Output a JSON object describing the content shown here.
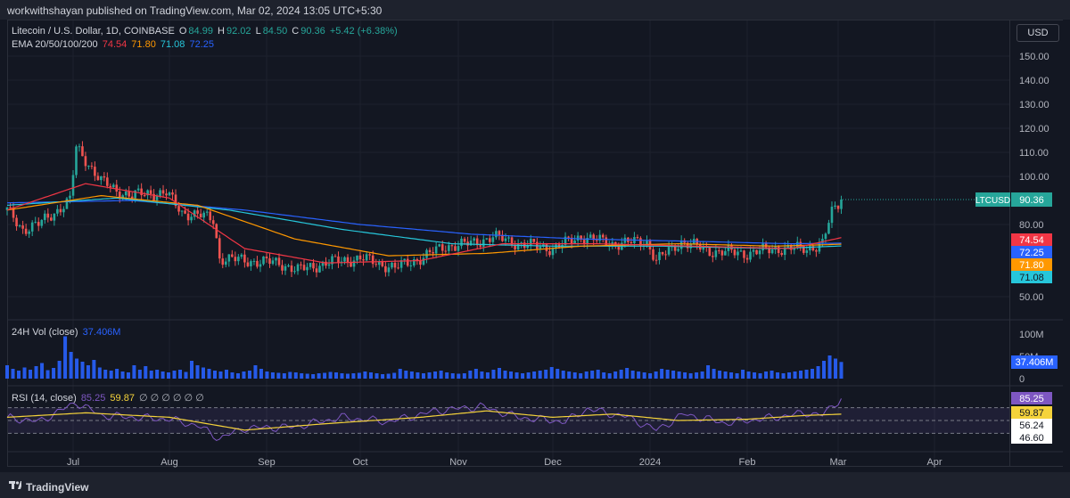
{
  "header": {
    "published_text": "workwithshayan published on TradingView.com, Mar 02, 2024 13:05 UTC+5:30"
  },
  "legend": {
    "symbol": "Litecoin / U.S. Dollar, 1D, COINBASE",
    "o_label": "O",
    "o_value": "84.99",
    "h_label": "H",
    "h_value": "92.02",
    "l_label": "L",
    "l_value": "84.50",
    "c_label": "C",
    "c_value": "90.36",
    "change": "+5.42 (+6.38%)",
    "ema_label": "EMA 20/50/100/200",
    "ema20": "74.54",
    "ema50": "71.80",
    "ema100": "71.08",
    "ema200": "72.25"
  },
  "volume_legend": {
    "label": "24H Vol (close)",
    "value": "37.406M"
  },
  "rsi_legend": {
    "label": "RSI (14, close)",
    "rsi": "85.25",
    "ma": "59.87",
    "extra": "∅ ∅ ∅ ∅ ∅ ∅"
  },
  "currency_button": "USD",
  "footer": {
    "brand": "TradingView"
  },
  "colors": {
    "up": "#26a69a",
    "down": "#ef5350",
    "ema20": "#f23645",
    "ema50": "#ff9800",
    "ema100": "#26c6da",
    "ema200": "#2962ff",
    "volume": "#2962ff",
    "rsi": "#7e57c2",
    "rsi_ma": "#f5d33b"
  },
  "chart_data": [
    {
      "type": "candlestick",
      "title": "Litecoin / U.S. Dollar, 1D, COINBASE",
      "ylim": [
        40,
        160
      ],
      "yticks": [
        "150.00",
        "140.00",
        "130.00",
        "120.00",
        "110.00",
        "100.00",
        "80.00",
        "50.00"
      ],
      "ytick_values": [
        150,
        140,
        130,
        120,
        110,
        100,
        80,
        50
      ],
      "xticks": [
        "Jul",
        "Aug",
        "Sep",
        "Oct",
        "Nov",
        "Dec",
        "2024",
        "Feb",
        "Mar",
        "Apr"
      ],
      "last_price_label": "LTCUSD",
      "last_price": "90.36",
      "ema_tags": [
        {
          "label": "74.54",
          "value": 74.54,
          "series": "ema20"
        },
        {
          "label": "72.25",
          "value": 72.25,
          "series": "ema200"
        },
        {
          "label": "71.80",
          "value": 71.8,
          "series": "ema50"
        },
        {
          "label": "71.08",
          "value": 71.08,
          "series": "ema100"
        }
      ],
      "price_keypoints": [
        {
          "x": "Jun 10",
          "y": 86
        },
        {
          "x": "Jun 15",
          "y": 78
        },
        {
          "x": "Jun 20",
          "y": 80
        },
        {
          "x": "Jun 25",
          "y": 85
        },
        {
          "x": "Jun 30",
          "y": 90
        },
        {
          "x": "Jul 2",
          "y": 112
        },
        {
          "x": "Jul 5",
          "y": 107
        },
        {
          "x": "Jul 10",
          "y": 98
        },
        {
          "x": "Jul 15",
          "y": 94
        },
        {
          "x": "Jul 20",
          "y": 92
        },
        {
          "x": "Jul 25",
          "y": 93
        },
        {
          "x": "Jul 31",
          "y": 93
        },
        {
          "x": "Aug 5",
          "y": 85
        },
        {
          "x": "Aug 10",
          "y": 84
        },
        {
          "x": "Aug 15",
          "y": 82
        },
        {
          "x": "Aug 17",
          "y": 66
        },
        {
          "x": "Aug 25",
          "y": 65
        },
        {
          "x": "Sep 5",
          "y": 64
        },
        {
          "x": "Sep 11",
          "y": 61
        },
        {
          "x": "Sep 20",
          "y": 64
        },
        {
          "x": "Oct 1",
          "y": 66
        },
        {
          "x": "Oct 12",
          "y": 62
        },
        {
          "x": "Oct 20",
          "y": 66
        },
        {
          "x": "Oct 28",
          "y": 71
        },
        {
          "x": "Nov 5",
          "y": 72
        },
        {
          "x": "Nov 12",
          "y": 75
        },
        {
          "x": "Nov 20",
          "y": 72
        },
        {
          "x": "Dec 1",
          "y": 70
        },
        {
          "x": "Dec 10",
          "y": 75
        },
        {
          "x": "Dec 20",
          "y": 72
        },
        {
          "x": "Dec 31",
          "y": 73
        },
        {
          "x": "Jan 3",
          "y": 65
        },
        {
          "x": "Jan 11",
          "y": 73
        },
        {
          "x": "Jan 20",
          "y": 69
        },
        {
          "x": "Feb 1",
          "y": 68
        },
        {
          "x": "Feb 10",
          "y": 70
        },
        {
          "x": "Feb 20",
          "y": 70
        },
        {
          "x": "Feb 25",
          "y": 72
        },
        {
          "x": "Feb 28",
          "y": 85
        },
        {
          "x": "Mar 2",
          "y": 90.36
        }
      ],
      "ema20_keypoints": [
        {
          "x": "Jun 10",
          "y": 86
        },
        {
          "x": "Jul 5",
          "y": 97
        },
        {
          "x": "Aug 1",
          "y": 91
        },
        {
          "x": "Aug 25",
          "y": 70
        },
        {
          "x": "Sep 20",
          "y": 64
        },
        {
          "x": "Oct 20",
          "y": 65
        },
        {
          "x": "Nov 15",
          "y": 72
        },
        {
          "x": "Dec 15",
          "y": 72
        },
        {
          "x": "Jan 15",
          "y": 71
        },
        {
          "x": "Feb 15",
          "y": 70
        },
        {
          "x": "Mar 2",
          "y": 74.54
        }
      ],
      "ema50_keypoints": [
        {
          "x": "Jun 10",
          "y": 86
        },
        {
          "x": "Jul 10",
          "y": 92
        },
        {
          "x": "Aug 10",
          "y": 88
        },
        {
          "x": "Sep 10",
          "y": 74
        },
        {
          "x": "Oct 10",
          "y": 67
        },
        {
          "x": "Nov 10",
          "y": 68
        },
        {
          "x": "Dec 10",
          "y": 71
        },
        {
          "x": "Jan 10",
          "y": 72
        },
        {
          "x": "Feb 10",
          "y": 71
        },
        {
          "x": "Mar 2",
          "y": 71.8
        }
      ],
      "ema100_keypoints": [
        {
          "x": "Jun 10",
          "y": 88
        },
        {
          "x": "Jul 15",
          "y": 91
        },
        {
          "x": "Aug 20",
          "y": 86
        },
        {
          "x": "Sep 25",
          "y": 78
        },
        {
          "x": "Oct 30",
          "y": 72
        },
        {
          "x": "Dec 1",
          "y": 71
        },
        {
          "x": "Jan 5",
          "y": 71
        },
        {
          "x": "Feb 10",
          "y": 70
        },
        {
          "x": "Mar 2",
          "y": 71.08
        }
      ],
      "ema200_keypoints": [
        {
          "x": "Jun 10",
          "y": 89
        },
        {
          "x": "Jul 20",
          "y": 90
        },
        {
          "x": "Aug 25",
          "y": 86
        },
        {
          "x": "Oct 1",
          "y": 80
        },
        {
          "x": "Nov 5",
          "y": 76
        },
        {
          "x": "Dec 10",
          "y": 74
        },
        {
          "x": "Jan 15",
          "y": 73
        },
        {
          "x": "Feb 15",
          "y": 72
        },
        {
          "x": "Mar 2",
          "y": 72.25
        }
      ]
    },
    {
      "type": "bar",
      "title": "24H Vol (close)",
      "yticks": [
        "100M",
        "50M",
        "0"
      ],
      "ytick_values": [
        100,
        50,
        0
      ],
      "ylim": [
        0,
        110
      ],
      "last_label": "37.406M",
      "values_m": [
        30,
        22,
        18,
        25,
        20,
        28,
        35,
        19,
        24,
        40,
        95,
        60,
        45,
        38,
        30,
        42,
        25,
        20,
        18,
        22,
        16,
        14,
        30,
        20,
        28,
        18,
        20,
        16,
        14,
        18,
        20,
        15,
        40,
        30,
        25,
        22,
        18,
        16,
        20,
        14,
        12,
        16,
        18,
        30,
        22,
        16,
        14,
        13,
        12,
        15,
        14,
        12,
        11,
        10,
        12,
        13,
        15,
        14,
        12,
        11,
        12,
        13,
        16,
        14,
        12,
        10,
        11,
        13,
        22,
        18,
        16,
        14,
        12,
        14,
        16,
        18,
        14,
        12,
        11,
        12,
        18,
        22,
        16,
        14,
        20,
        24,
        18,
        16,
        14,
        12,
        14,
        16,
        18,
        20,
        26,
        22,
        18,
        16,
        14,
        12,
        16,
        18,
        20,
        14,
        12,
        16,
        20,
        24,
        18,
        16,
        14,
        12,
        16,
        22,
        20,
        18,
        16,
        14,
        12,
        14,
        16,
        30,
        22,
        18,
        16,
        14,
        12,
        20,
        16,
        14,
        12,
        16,
        18,
        14,
        12,
        14,
        16,
        18,
        20,
        22,
        28,
        40,
        52,
        45,
        37.4
      ]
    },
    {
      "type": "line",
      "title": "RSI (14, close)",
      "ylim": [
        20,
        100
      ],
      "levels": [
        70,
        50,
        30
      ],
      "tags": [
        {
          "label": "85.25",
          "value": 85.25,
          "series": "rsi"
        },
        {
          "label": "59.87",
          "value": 59.87,
          "series": "ma"
        },
        {
          "label": "56.24",
          "value": 56.24,
          "series": "plain"
        },
        {
          "label": "46.60",
          "value": 46.6,
          "series": "plain"
        }
      ],
      "rsi_keypoints": [
        {
          "x": "Jun 10",
          "y": 55
        },
        {
          "x": "Jun 20",
          "y": 48
        },
        {
          "x": "Jul 2",
          "y": 78
        },
        {
          "x": "Jul 10",
          "y": 58
        },
        {
          "x": "Jul 20",
          "y": 55
        },
        {
          "x": "Aug 1",
          "y": 52
        },
        {
          "x": "Aug 10",
          "y": 42
        },
        {
          "x": "Aug 17",
          "y": 22
        },
        {
          "x": "Aug 25",
          "y": 38
        },
        {
          "x": "Sep 10",
          "y": 40
        },
        {
          "x": "Sep 25",
          "y": 55
        },
        {
          "x": "Oct 10",
          "y": 48
        },
        {
          "x": "Oct 25",
          "y": 65
        },
        {
          "x": "Nov 8",
          "y": 72
        },
        {
          "x": "Nov 20",
          "y": 55
        },
        {
          "x": "Dec 5",
          "y": 48
        },
        {
          "x": "Dec 12",
          "y": 68
        },
        {
          "x": "Dec 25",
          "y": 55
        },
        {
          "x": "Jan 3",
          "y": 35
        },
        {
          "x": "Jan 12",
          "y": 60
        },
        {
          "x": "Jan 25",
          "y": 46
        },
        {
          "x": "Feb 10",
          "y": 55
        },
        {
          "x": "Feb 20",
          "y": 62
        },
        {
          "x": "Feb 25",
          "y": 58
        },
        {
          "x": "Mar 2",
          "y": 85.25
        }
      ],
      "ma_keypoints": [
        {
          "x": "Jun 10",
          "y": 55
        },
        {
          "x": "Jul 5",
          "y": 62
        },
        {
          "x": "Aug 1",
          "y": 55
        },
        {
          "x": "Aug 25",
          "y": 35
        },
        {
          "x": "Sep 20",
          "y": 45
        },
        {
          "x": "Oct 20",
          "y": 55
        },
        {
          "x": "Nov 10",
          "y": 65
        },
        {
          "x": "Dec 1",
          "y": 55
        },
        {
          "x": "Dec 20",
          "y": 60
        },
        {
          "x": "Jan 10",
          "y": 50
        },
        {
          "x": "Feb 1",
          "y": 52
        },
        {
          "x": "Feb 20",
          "y": 58
        },
        {
          "x": "Mar 2",
          "y": 59.87
        }
      ]
    }
  ]
}
